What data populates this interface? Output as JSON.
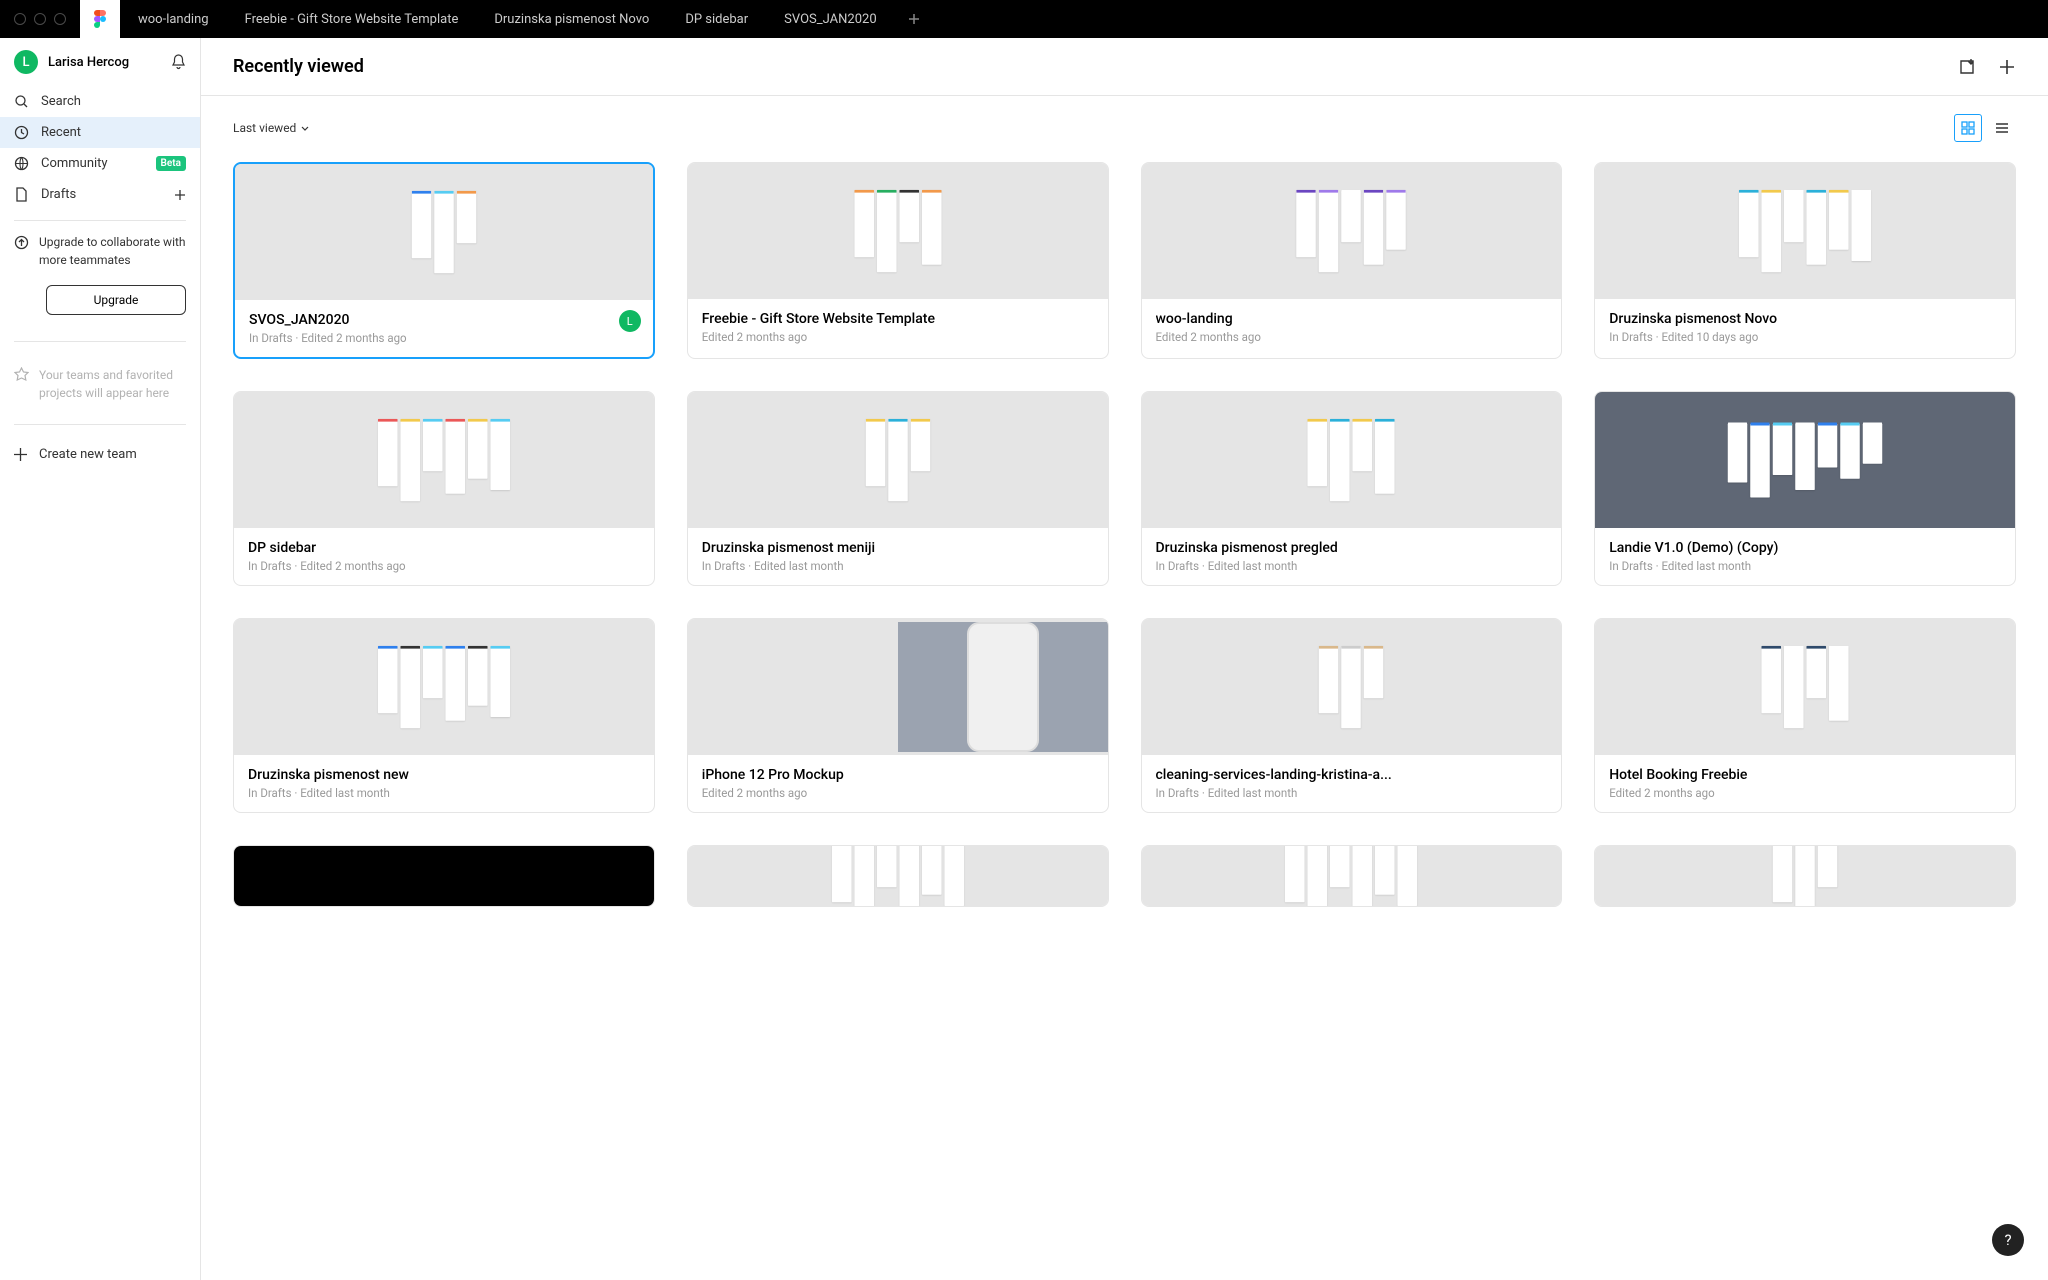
{
  "titlebar": {
    "tabs": [
      "woo-landing",
      "Freebie - Gift Store Website Template",
      "Druzinska pismenost Novo",
      "DP sidebar",
      "SVOS_JAN2020"
    ]
  },
  "sidebar": {
    "user": {
      "initial": "L",
      "name": "Larisa Hercog"
    },
    "search": "Search",
    "recent": "Recent",
    "community": "Community",
    "community_badge": "Beta",
    "drafts": "Drafts",
    "upgrade_text": "Upgrade to collaborate with more teammates",
    "upgrade_btn": "Upgrade",
    "favorites_text": "Your teams and favorited projects will appear here",
    "create_team": "Create new team"
  },
  "header": {
    "title": "Recently viewed"
  },
  "sort_label": "Last viewed",
  "cards": [
    {
      "title": "SVOS_JAN2020",
      "meta": "In Drafts · Edited 2 months ago",
      "selected": true,
      "avatar": "L",
      "thumb": "mini"
    },
    {
      "title": "Freebie - Gift Store Website Template",
      "meta": "Edited 2 months ago",
      "thumb": "mini"
    },
    {
      "title": "woo-landing",
      "meta": "Edited 2 months ago",
      "thumb": "mini"
    },
    {
      "title": "Druzinska pismenost Novo",
      "meta": "In Drafts · Edited 10 days ago",
      "thumb": "mini"
    },
    {
      "title": "DP sidebar",
      "meta": "In Drafts · Edited 2 months ago",
      "thumb": "mini"
    },
    {
      "title": "Druzinska pismenost meniji",
      "meta": "In Drafts · Edited last month",
      "thumb": "mini"
    },
    {
      "title": "Druzinska pismenost pregled",
      "meta": "In Drafts · Edited last month",
      "thumb": "mini"
    },
    {
      "title": "Landie V1.0 (Demo) (Copy)",
      "meta": "In Drafts · Edited last month",
      "thumb": "dark"
    },
    {
      "title": "Druzinska pismenost new",
      "meta": "In Drafts · Edited last month",
      "thumb": "mini"
    },
    {
      "title": "iPhone 12 Pro Mockup",
      "meta": "Edited 2 months ago",
      "thumb": "phone"
    },
    {
      "title": "cleaning-services-landing-kristina-a...",
      "meta": "In Drafts · Edited last month",
      "thumb": "mini"
    },
    {
      "title": "Hotel Booking Freebie",
      "meta": "Edited 2 months ago",
      "thumb": "mini"
    },
    {
      "title": "",
      "meta": "",
      "thumb": "black"
    },
    {
      "title": "",
      "meta": "",
      "thumb": "mini"
    },
    {
      "title": "",
      "meta": "",
      "thumb": "mini"
    },
    {
      "title": "",
      "meta": "",
      "thumb": "mini"
    }
  ],
  "help": "?"
}
